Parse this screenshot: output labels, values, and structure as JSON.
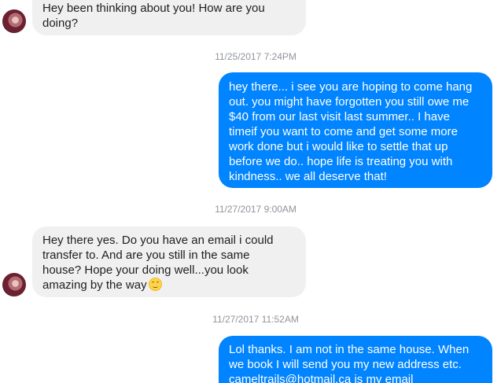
{
  "messages": [
    {
      "direction": "incoming",
      "text": "Hey been thinking about you! How are you\ndoing?"
    },
    {
      "direction": "outgoing",
      "text": "hey there... i see you are hoping to come hang\nout. you might have forgotten you still owe me\n$40 from our last visit last summer.. I have\ntimeif you want to come and get some more\nwork done but i would like to settle that up\nbefore we do.. hope life is treating you with\nkindness.. we all deserve that!"
    },
    {
      "direction": "incoming",
      "text": "Hey there yes. Do you have an email i could\ntransfer to. And are you still in the same\nhouse? Hope your doing well...you look\namazing by the way",
      "emoji": "smiling-face-icon"
    },
    {
      "direction": "outgoing",
      "text": "Lol thanks. I am not in the same house.  When\nwe book I will send you my new address etc.\ncameltrails@hotmail.ca is my email"
    }
  ],
  "timestamps": [
    "11/25/2017 7:24PM",
    "11/27/2017 9:00AM",
    "11/27/2017 11:52AM"
  ],
  "colors": {
    "outgoing_bubble": "#0084ff",
    "incoming_bubble": "#f1f0f0",
    "timestamp": "#90949c"
  }
}
